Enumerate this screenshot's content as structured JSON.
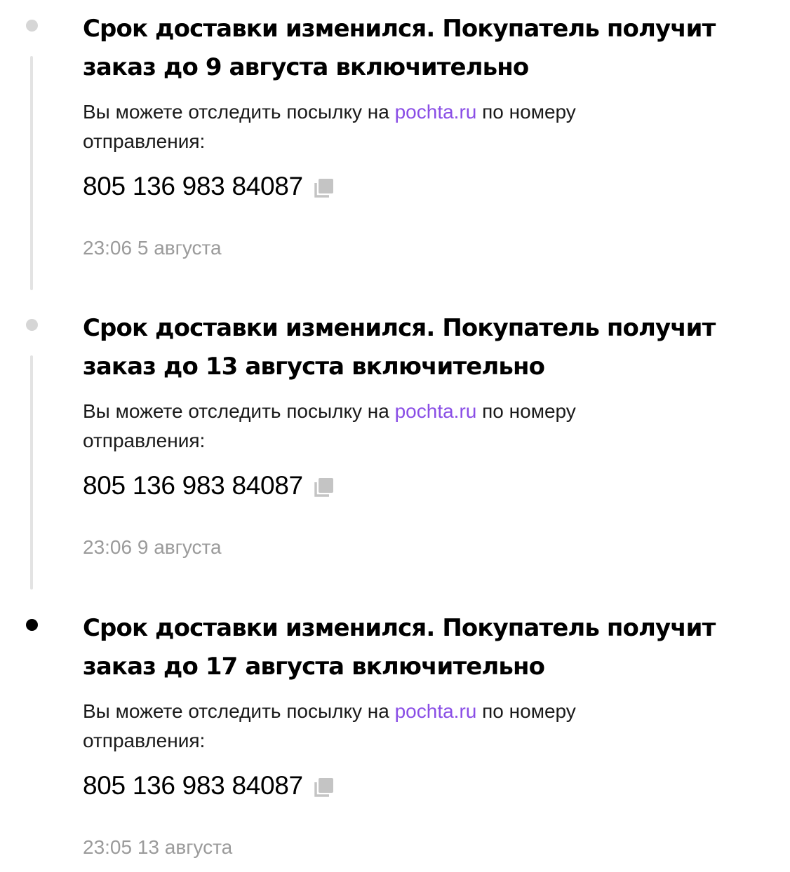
{
  "events": [
    {
      "title_line1": "Срок доставки изменился. Покупатель получит",
      "title_line2": "заказ до 9 августа включительно",
      "desc_prefix": "Вы можете отследить посылку на ",
      "desc_link": "pochta.ru",
      "desc_suffix": " по номеру",
      "desc_line2": "отправления:",
      "tracking_number": "805 136 983 84087",
      "timestamp": "23:06 5 августа",
      "active": false
    },
    {
      "title_line1": "Срок доставки изменился. Покупатель получит",
      "title_line2": "заказ до 13 августа включительно",
      "desc_prefix": "Вы можете отследить посылку на ",
      "desc_link": "pochta.ru",
      "desc_suffix": " по номеру",
      "desc_line2": "отправления:",
      "tracking_number": "805 136 983 84087",
      "timestamp": "23:06 9 августа",
      "active": false
    },
    {
      "title_line1": "Срок доставки изменился. Покупатель получит",
      "title_line2": "заказ до 17 августа включительно",
      "desc_prefix": "Вы можете отследить посылку на ",
      "desc_link": "pochta.ru",
      "desc_suffix": " по номеру",
      "desc_line2": "отправления:",
      "tracking_number": "805 136 983 84087",
      "timestamp": "23:05 13 августа",
      "active": true
    }
  ],
  "colors": {
    "link": "#8a4ee6",
    "timestamp": "#9b9b9b",
    "dot_inactive": "#d6d6d6",
    "dot_active": "#000000",
    "rail": "#e3e3e3",
    "copy_icon": "#c4c4c4"
  },
  "icons": {
    "copy": "copy-icon",
    "dot": "timeline-dot-icon"
  }
}
